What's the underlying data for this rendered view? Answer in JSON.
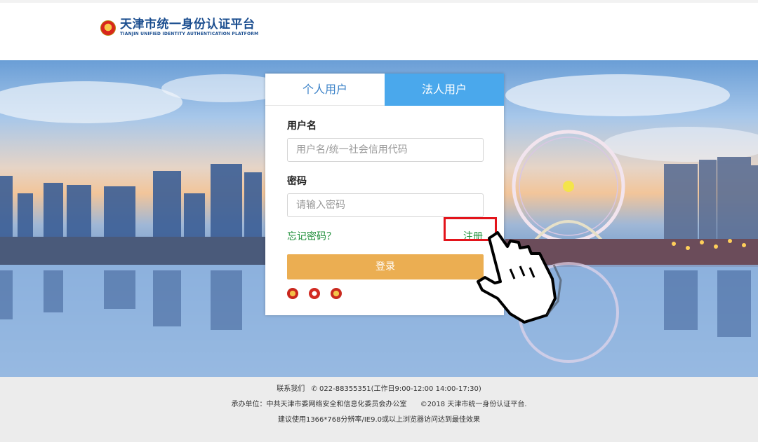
{
  "header": {
    "title_cn": "天津市统一身份认证平台",
    "title_en": "TIANJIN UNIFIED IDENTITY AUTHENTICATION PLATFORM",
    "emblem_icon": "national-emblem-icon"
  },
  "login": {
    "tabs": [
      {
        "label": "个人用户",
        "active": false
      },
      {
        "label": "法人用户",
        "active": true
      }
    ],
    "username_label": "用户名",
    "username_placeholder": "用户名/统一社会信用代码",
    "password_label": "密码",
    "password_placeholder": "请输入密码",
    "forgot_label": "忘记密码？",
    "register_label": "注册",
    "login_button": "登录"
  },
  "footer": {
    "contact_label": "联系我们",
    "phone": "022-88355351(工作日9:00-12:00 14:00-17:30)",
    "organizer": "承办单位：中共天津市委网络安全和信息化委员会办公室",
    "copyright": "©2018 天津市统一身份认证平台.",
    "browser_tip": "建议使用1366*768分辨率/IE9.0或以上浏览器访问达到最佳效果"
  },
  "colors": {
    "accent_blue": "#4aa8ec",
    "login_button": "#ebae52",
    "link_green": "#1f8f3a",
    "highlight_red": "#e3141b"
  }
}
